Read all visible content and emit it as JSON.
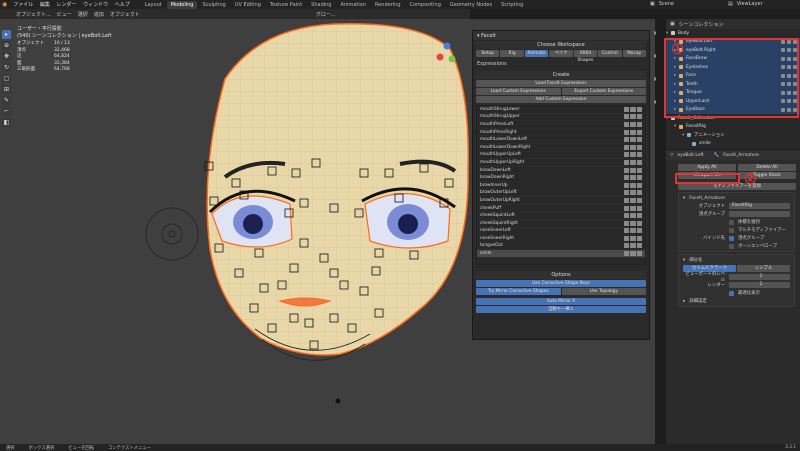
{
  "menu": [
    "ファイル",
    "編集",
    "レンダー",
    "ウィンドウ",
    "ヘルプ"
  ],
  "workspaces": [
    "Layout",
    "Modeling",
    "Sculpting",
    "UV Editing",
    "Texture Paint",
    "Shading",
    "Animation",
    "Rendering",
    "Compositing",
    "Geometry Nodes",
    "Scripting"
  ],
  "active_workspace": "Modeling",
  "scene": "Scene",
  "view_layer": "ViewLayer",
  "viewport_header": {
    "mode": "オブジェクト...",
    "items": [
      "ビュー",
      "選択",
      "追加",
      "オブジェクト"
    ],
    "transform": "グロー..."
  },
  "stats": {
    "title": "ユーザー・平行投影",
    "collection": "(540) シーンコレクション | eyeBolt.Left",
    "rows": [
      [
        "オブジェクト",
        "10 / 13"
      ],
      [
        "頂点",
        "32,468"
      ],
      [
        "辺",
        "64,824"
      ],
      [
        "面",
        "32,384"
      ],
      [
        "三角形面",
        "64,768"
      ]
    ]
  },
  "facelit": {
    "header": "FaceIt",
    "workspace_title": "Choose Workspace",
    "tabs": [
      "Setup",
      "Rig",
      "Animate",
      "ベイク",
      "ARKit Shapes",
      "Control",
      "Mocap"
    ],
    "active_tab": "Animate",
    "expressions_label": "Expressions",
    "create_label": "Create",
    "load_expressions": "Load FaceIt Expressions",
    "load_custom": "Load Custom Expressions",
    "export_custom": "Export Custom Expressions",
    "add_custom": "Add Custom Expression",
    "items": [
      "mouthShrugLower",
      "mouthShrugUpper",
      "mouthPressLeft",
      "mouthPressRight",
      "mouthLowerDownLeft",
      "mouthLowerDownRight",
      "mouthUpperUpLeft",
      "mouthUpperUpRight",
      "browDownLeft",
      "browDownRight",
      "browInnerUp",
      "browOuterUpLeft",
      "browOuterUpRight",
      "cheekPuff",
      "cheekSquintLeft",
      "cheekSquintRight",
      "noseSneerLeft",
      "noseSneerRight",
      "tongueOut",
      "smile"
    ],
    "selected_item": "smile",
    "options_label": "Options",
    "use_corrective": "Use Corrective Shape Keys",
    "try_mirror": "Try Mirror Corrective Shapes",
    "use_topology": "Use Topology",
    "auto_mirror": "Auto Mirror X",
    "animate_all": "自動キー挿入"
  },
  "outliner": {
    "header": "シーンコレクション",
    "root": "Body",
    "items": [
      "eyeBolt.Left",
      "eyeBolt.Right",
      "FaceBrow",
      "Eyelashes",
      "Face",
      "Teeth",
      "Tongue",
      "UpperLash",
      "EyeBase"
    ],
    "collection": "FaceIt_Collection",
    "rig": "FaceitRig",
    "anim": "アニメーション",
    "child": "smile"
  },
  "properties": {
    "object": "eyeBolt.Left",
    "armature": "FaceIt_Armature",
    "apply_all": "Apply All",
    "delete_all": "Delete All",
    "viewport_vis": "Viewport Vis",
    "toggle_stack": "Toggle Stack",
    "add_modifier": "モディファイアーを追加",
    "mod1": {
      "name": "FaceIt_Armature",
      "object_label": "オブジェクト",
      "object_value": "FaceitRig",
      "vgroup_label": "頂点グループ",
      "preserve_volume": "体積を維持",
      "multi_modifier": "マルチモディファイアー",
      "bind_to": "バインド先",
      "vertex_groups": "頂点グループ",
      "bone_envelopes": "ボーンエンベロープ"
    },
    "mod2": {
      "name": "細分化",
      "catmull": "カトムルクラーク",
      "simple": "シンプル",
      "levels_viewport_label": "ビューポートのレベル",
      "levels_viewport": "1",
      "render_label": "レンダー",
      "render": "2",
      "optimal": "最適化表示",
      "advanced": "詳細設定"
    },
    "annotation": "2"
  },
  "annotation_1": "1",
  "statusbar": [
    "選択",
    "ボックス選択",
    "ビューを回転",
    "コンテクストメニュー"
  ],
  "version": "3.3.1",
  "colors": {
    "accent": "#4772b3",
    "highlight": "#e33333",
    "face": "#f0dfb0",
    "iris": "#7c8bd6"
  }
}
